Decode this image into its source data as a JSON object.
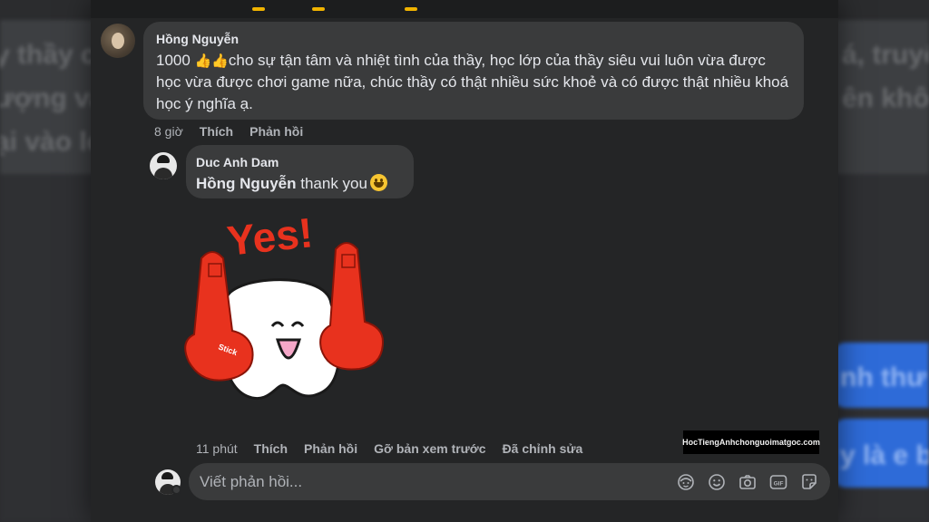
{
  "background": {
    "left_text_1": "y thầy c",
    "left_text_2": "ượng và",
    "left_text_3": "ại vào lớ",
    "right_text_1": "á, truyệ",
    "right_text_2": "ên khôn",
    "blue_text_1": "nh thư",
    "blue_text_2": "y là e b"
  },
  "comment": {
    "author": "Hồng Nguyễn",
    "text_prefix": "1000 ",
    "emoji": "👍👍",
    "text": "cho sự tận tâm và nhiệt tình của thầy, học lớp của thầy siêu vui luôn vừa được học vừa được chơi game nữa, chúc thầy có thật nhiều sức khoẻ và có được thật nhiều khoá học ý nghĩa ạ.",
    "time": "8 giờ",
    "like_label": "Thích",
    "reply_label": "Phản hồi"
  },
  "reply": {
    "author": "Duc Anh Dam",
    "mention": "Hồng Nguyễn",
    "text": "thank you",
    "sticker_text": "Yes!",
    "sticker_glove_text": "Stick",
    "time": "11 phút",
    "like_label": "Thích",
    "reply_label": "Phản hồi",
    "remove_preview_label": "Gỡ bản xem trước",
    "edited_label": "Đã chỉnh sửa"
  },
  "watermark": "HocTiengAnhchonguoimatgoc.com",
  "composer": {
    "placeholder": "Viết phản hồi...",
    "tools": [
      "avatar-sticker-icon",
      "emoji-icon",
      "camera-icon",
      "gif-icon",
      "sticker-icon"
    ],
    "gif_label": "GIF"
  },
  "colors": {
    "panel": "#242526",
    "bubble": "#3a3b3c",
    "text_primary": "#e4e6eb",
    "text_secondary": "#b0b3b8",
    "sticker_red": "#e8321e"
  }
}
